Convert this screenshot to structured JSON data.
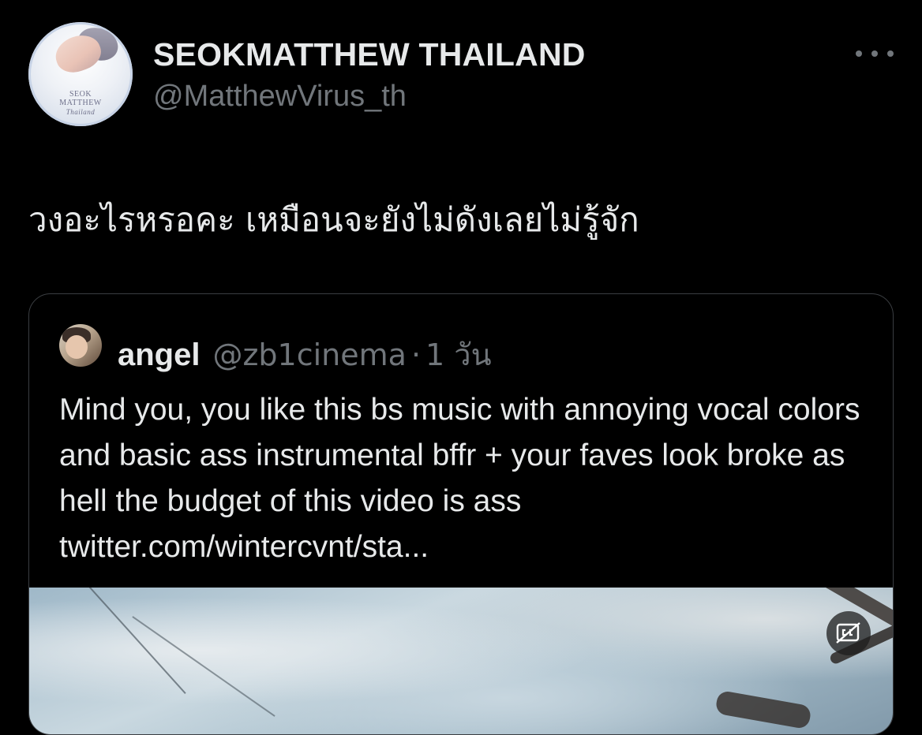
{
  "author": {
    "display_name": "SEOKMATTHEW THAILAND",
    "handle": "@MatthewVirus_th",
    "avatar_text": [
      "SEOK",
      "MATTHEW",
      "Thailand"
    ]
  },
  "tweet": {
    "text": "วงอะไรหรอคะ เหมือนจะยังไม่ดังเลยไม่รู้จัก"
  },
  "quoted_tweet": {
    "name": "angel",
    "handle": "@zb1cinema",
    "separator": "·",
    "time": "1 วัน",
    "text": "Mind you, you like this bs music with annoying vocal colors and basic ass instrumental bffr + your faves look broke as hell the budget of this video is ass twitter.com/wintercvnt/sta..."
  },
  "icons": {
    "more": "more-dots-icon",
    "captions": "closed-captions-off-icon"
  },
  "colors": {
    "background": "#000000",
    "primary_text": "#e7e9ea",
    "secondary_text": "#71767b",
    "border": "#3a3d41"
  }
}
